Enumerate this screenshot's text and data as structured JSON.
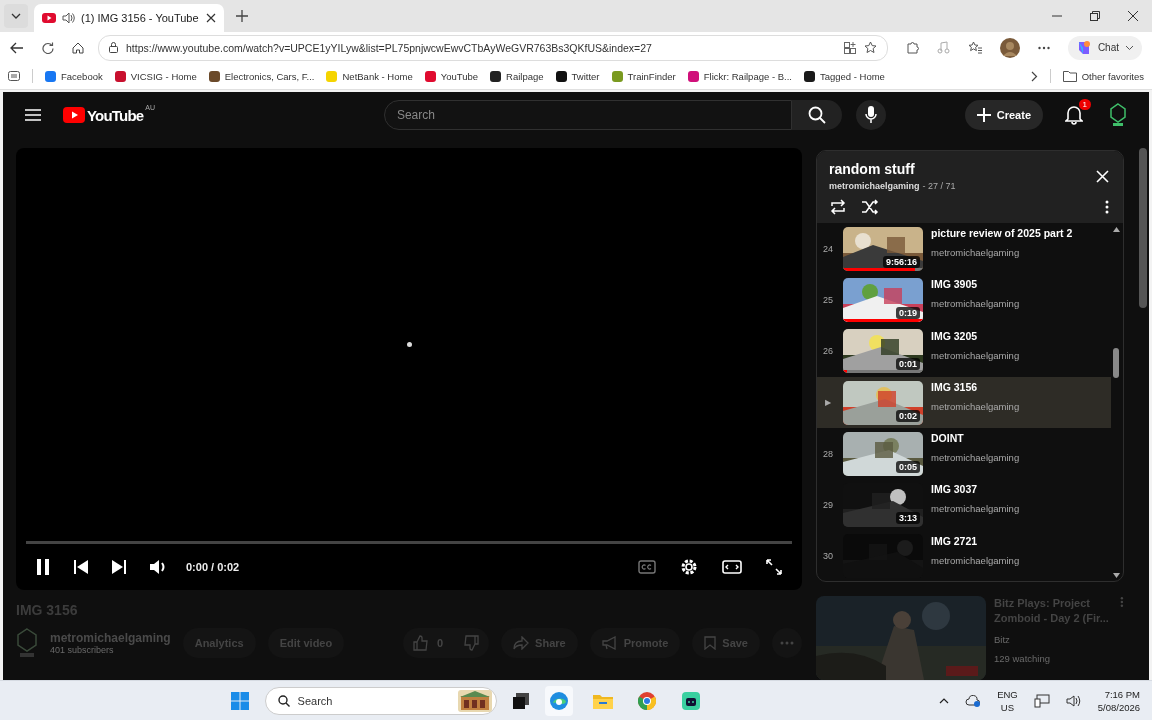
{
  "browser": {
    "tab_title": "(1) IMG 3156 - YouTube",
    "url": "https://www.youtube.com/watch?v=UPCE1yYILyw&list=PL75pnjwcwEwvCTbAyWeGVR763Bs3QKfUS&index=27",
    "chat_label": "Chat",
    "other_favorites": "Other favorites",
    "bookmarks": [
      {
        "label": "Facebook",
        "color": "#1877f2"
      },
      {
        "label": "VICSIG - Home",
        "color": "#c8102e"
      },
      {
        "label": "Electronics, Cars, F...",
        "color": "#6b4a2a"
      },
      {
        "label": "NetBank - Home",
        "color": "#f5d400"
      },
      {
        "label": "YouTube",
        "color": "#e00b2f"
      },
      {
        "label": "Railpage",
        "color": "#222222"
      },
      {
        "label": "Twitter",
        "color": "#111111"
      },
      {
        "label": "TrainFinder",
        "color": "#7a9a20"
      },
      {
        "label": "Flickr: Railpage - B...",
        "color": "#d0107a"
      },
      {
        "label": "Tagged - Home",
        "color": "#1a1a1a"
      }
    ]
  },
  "youtube": {
    "logo_text": "YouTube",
    "region": "AU",
    "search_placeholder": "Search",
    "create_label": "Create",
    "notification_count": "1"
  },
  "player": {
    "playing": true,
    "time": "0:00 / 0:02",
    "level": 0
  },
  "playlist": {
    "title": "random stuff",
    "owner": "metromichaelgaming",
    "position": "- 27 / 71",
    "items": [
      {
        "index": "24",
        "title": "picture review of 2025 part 2",
        "channel": "metromichaelgaming",
        "duration": "9:56:16",
        "level": 0.9,
        "selected": false
      },
      {
        "index": "25",
        "title": "IMG 3905",
        "channel": "metromichaelgaming",
        "duration": "0:19",
        "level": 1,
        "selected": false
      },
      {
        "index": "26",
        "title": "IMG 3205",
        "channel": "metromichaelgaming",
        "duration": "0:01",
        "level": 0.05,
        "selected": false
      },
      {
        "index": "▶",
        "title": "IMG 3156",
        "channel": "metromichaelgaming",
        "duration": "0:02",
        "selected": true
      },
      {
        "index": "28",
        "title": "DOINT",
        "channel": "metromichaelgaming",
        "duration": "0:05",
        "selected": false
      },
      {
        "index": "29",
        "title": "IMG 3037",
        "channel": "metromichaelgaming",
        "duration": "3:13",
        "selected": false
      },
      {
        "index": "30",
        "title": "IMG 2721",
        "channel": "metromichaelgaming",
        "selected": false
      }
    ]
  },
  "video_info": {
    "title": "IMG 3156",
    "channel": "metromichaelgaming",
    "subscribers": "401 subscribers",
    "actions": [
      "Analytics",
      "Edit video"
    ],
    "likes": "0",
    "share": "Share",
    "promote": "Promote",
    "save": "Save"
  },
  "recommendation": {
    "title": "Bitz Plays: Project Zomboid - Day 2 (Fir...",
    "channel": "Bitz",
    "viewers": "129 watching"
  },
  "taskbar": {
    "search_placeholder": "Search",
    "language": "ENG",
    "region": "US",
    "time": "7:16 PM",
    "date": "5/08/2026"
  }
}
